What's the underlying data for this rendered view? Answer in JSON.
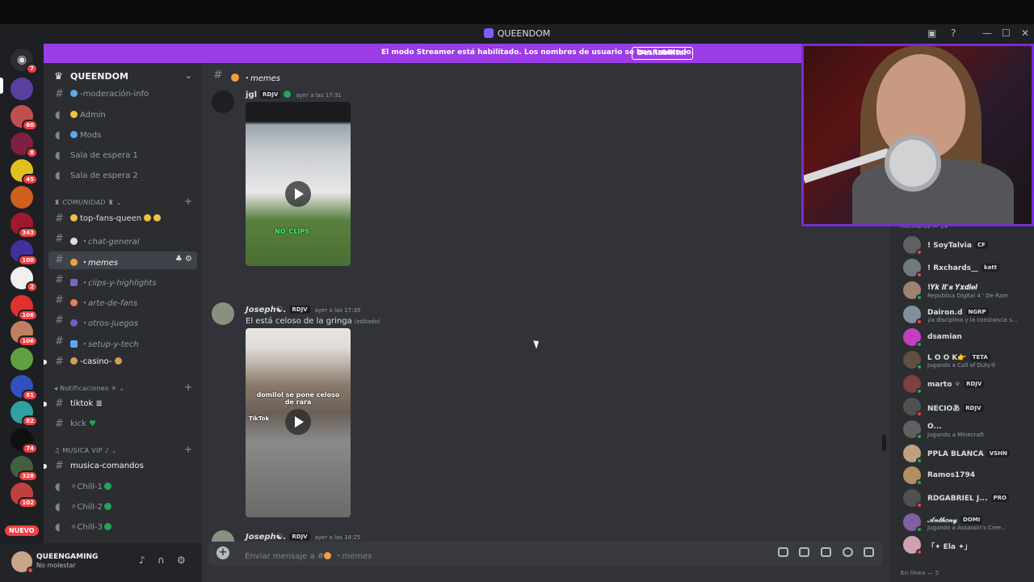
{
  "window": {
    "title": "QUEENDOM"
  },
  "banner": {
    "message": "El modo Streamer está habilitado. Los nombres de usuario se han truncado.",
    "button": "Deshabilitar"
  },
  "guilds": {
    "home_badge": "7",
    "items": [
      {
        "badge": "",
        "color": "#5b3fa0"
      },
      {
        "badge": "60",
        "color": "#c05050"
      },
      {
        "badge": "8",
        "color": "#802040"
      },
      {
        "badge": "45",
        "color": "#e0c020"
      },
      {
        "badge": "",
        "color": "#d06020"
      },
      {
        "badge": "343",
        "color": "#a01830"
      },
      {
        "badge": "100",
        "color": "#4030a0"
      },
      {
        "badge": "2",
        "color": "#f0f0f0"
      },
      {
        "badge": "106",
        "color": "#e03030"
      },
      {
        "badge": "106",
        "color": "#c08060"
      },
      {
        "badge": "",
        "color": "#60a040"
      },
      {
        "badge": "81",
        "color": "#3050c0"
      },
      {
        "badge": "82",
        "color": "#30a0a0"
      },
      {
        "badge": "74",
        "color": "#101010"
      },
      {
        "badge": "328",
        "color": "#406040"
      },
      {
        "badge": "102",
        "color": "#c04040"
      }
    ],
    "new_label": "NUEVO"
  },
  "server": {
    "name": "QUEENDOM"
  },
  "channels": {
    "top": [
      {
        "label": "-moderación-info",
        "type": "text"
      },
      {
        "label": "Admin",
        "type": "voice"
      },
      {
        "label": "Mods",
        "type": "voice"
      },
      {
        "label": "Sala de espera 1",
        "type": "voice"
      },
      {
        "label": "Sala de espera 2",
        "type": "voice"
      }
    ],
    "cat_comunidad": "COMUNIDAD",
    "comunidad": [
      {
        "label": "top-fans-queen",
        "italic": false
      },
      {
        "label": "・chat-general",
        "italic": true
      },
      {
        "label": "・memes",
        "italic": true
      },
      {
        "label": "・clips-y-highlights",
        "italic": true
      },
      {
        "label": "・arte-de-fans",
        "italic": true
      },
      {
        "label": "・otros-juegos",
        "italic": true
      },
      {
        "label": "・setup-y-tech",
        "italic": true
      },
      {
        "label": "-casino-",
        "italic": false
      }
    ],
    "cat_notificaciones": "Notificaciones",
    "notificaciones": [
      {
        "label": "tiktok"
      },
      {
        "label": "kick"
      }
    ],
    "cat_musica": "MUSICA VIP",
    "musica": [
      {
        "label": "musica-comandos"
      },
      {
        "label": "Chill-1"
      },
      {
        "label": "Chill-2"
      },
      {
        "label": "Chill-3"
      }
    ]
  },
  "user": {
    "name": "QUEENGAMING",
    "status": "No molestar"
  },
  "chat": {
    "channel_name": "・memes",
    "messages": [
      {
        "author": "jgl",
        "tag": "RDJV",
        "time": "ayer a las 17:31",
        "text": "",
        "video_caption": "NO_CLIPS"
      },
      {
        "author": "Joseph☯.",
        "tag": "RDJV",
        "time": "ayer a las 17:39",
        "text": "El está celoso de la gringa",
        "edited": "(editado)",
        "video_caption": "domilol se pone celoso de rara",
        "video_badge": "TikTok"
      },
      {
        "author": "Joseph☯.",
        "tag": "RDJV",
        "time": "ayer a las 18:25",
        "text": ""
      }
    ],
    "composer_placeholder": "Enviar mensaje a #",
    "composer_channel": "・memes"
  },
  "members": {
    "header": "Miembros — 14",
    "online_header": "En línea — 5",
    "list": [
      {
        "name": "! SoyTalvia",
        "tag": "CF",
        "sub": "",
        "status": "#f23f43",
        "color": "#606060"
      },
      {
        "name": "! Rxchards__",
        "tag": "katt",
        "sub": "",
        "status": "#f23f43",
        "color": "#707880"
      },
      {
        "name": "!𝒀𝒌 𝑰𝒕'𝒔 𝒀𝒙𝒅𝒊𝒆𝒍",
        "tag": "",
        "sub": "Republica Digital 4 ' De Ram",
        "status": "#23a55a",
        "color": "#a08070"
      },
      {
        "name": "Dairon.d",
        "tag": "NGRP",
        "sub": "¡la disciplina y la constancia s...",
        "status": "#f23f43",
        "color": "#8090a0"
      },
      {
        "name": "dsamian",
        "tag": "",
        "sub": "",
        "status": "#23a55a",
        "color": "#c040c0"
      },
      {
        "name": "L O O K👉",
        "tag": "TETA",
        "sub": "Jugando a Call of Duty®",
        "status": "#23a55a",
        "color": "#605040"
      },
      {
        "name": "marto ✧",
        "tag": "RDJV",
        "sub": "",
        "status": "#23a55a",
        "color": "#804040"
      },
      {
        "name": "NECIOあ",
        "tag": "RDJV",
        "sub": "",
        "status": "#f23f43",
        "color": "#505050"
      },
      {
        "name": "O...",
        "tag": "",
        "sub": "Jugando a Minecraft",
        "status": "#23a55a",
        "color": "#606060"
      },
      {
        "name": "PPLA BLANCA",
        "tag": "VSHN",
        "sub": "",
        "status": "#23a55a",
        "color": "#c0a080"
      },
      {
        "name": "Ramos1794",
        "tag": "",
        "sub": "",
        "status": "#23a55a",
        "color": "#b09060"
      },
      {
        "name": "RDGABRIEL J...",
        "tag": "PRO",
        "sub": "",
        "status": "#f23f43",
        "color": "#505050"
      },
      {
        "name": "𝒜𝓃𝓉𝒽𝑜𝓃𝓎",
        "tag": "DOMI",
        "sub": "Jugando a Assassin's Cree...",
        "status": "#23a55a",
        "color": "#8060a0"
      },
      {
        "name": "「✦ Ela ✦」",
        "tag": "",
        "sub": "",
        "status": "#f23f43",
        "color": "#d0a0b0"
      }
    ]
  }
}
